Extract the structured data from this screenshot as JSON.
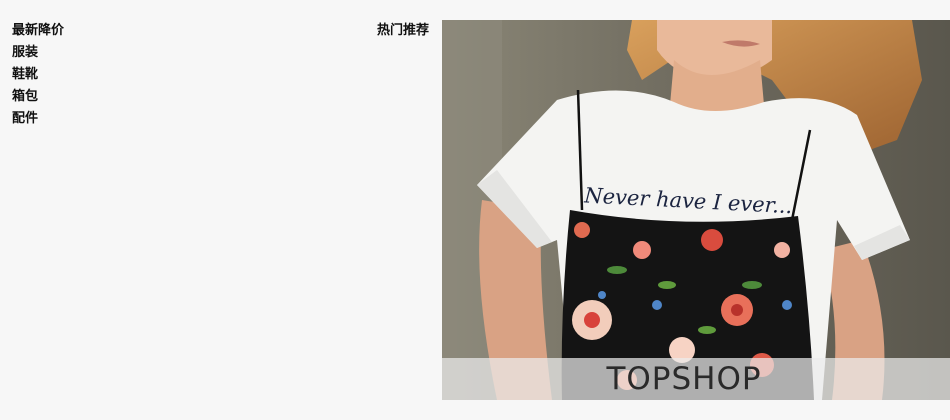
{
  "categories": [
    {
      "label": "最新降价"
    },
    {
      "label": "服装"
    },
    {
      "label": "鞋靴"
    },
    {
      "label": "箱包"
    },
    {
      "label": "配件"
    }
  ],
  "featured": {
    "heading": "热门推荐",
    "brand": "TOPSHOP",
    "tshirt_text": "Never have I ever..."
  },
  "colors": {
    "page_background": "#f7f7f7",
    "text": "#111111",
    "brand_bar": "#ebebeb"
  }
}
